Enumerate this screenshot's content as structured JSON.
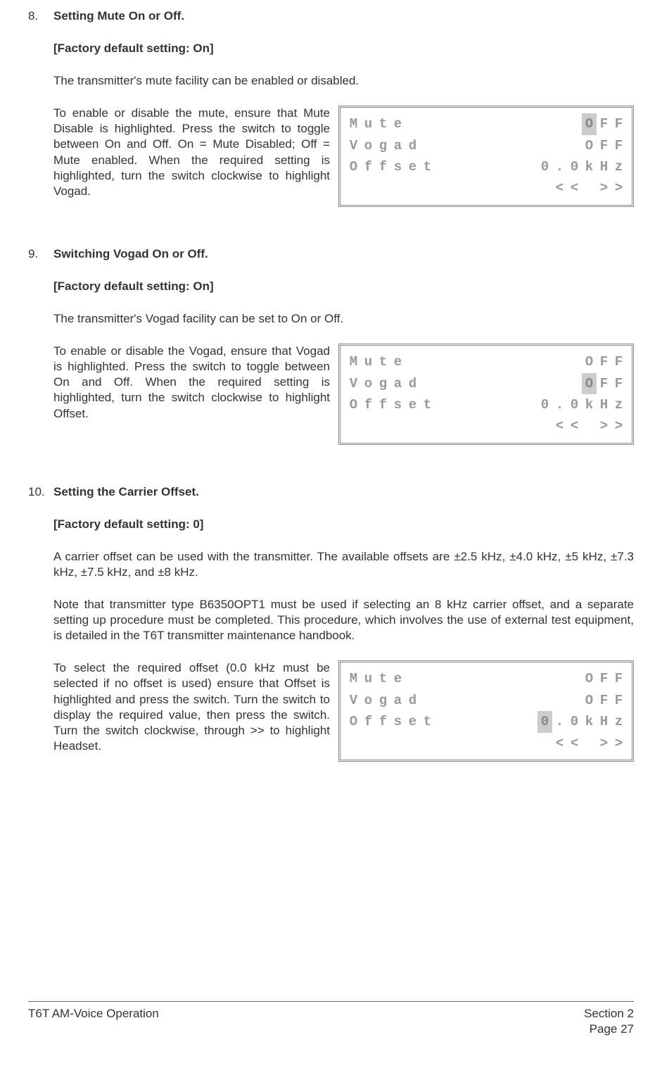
{
  "sections": [
    {
      "num": "8.",
      "title": "Setting Mute On or Off.",
      "default": "[Factory default setting: On]",
      "intro": "The transmitter's mute facility can be enabled or disabled.",
      "left_text": "To enable or disable the mute, ensure that Mute Disable is highlighted. Press the switch to toggle between On and Off. On = Mute Disabled; Off = Mute enabled. When the required setting is highlighted, turn the switch clockwise to highlight Vogad.",
      "lcd": {
        "row1_left": "Mute",
        "row1_right": "OFF",
        "row1_hl": 0,
        "row2_left": "Vogad",
        "row2_right": "OFF",
        "row2_hl": -1,
        "row3_left": "Offset",
        "row3_right": "0.0kHz",
        "row3_hl": -1,
        "row4_left": "",
        "row4_right": "<< >>"
      }
    },
    {
      "num": "9.",
      "title": "Switching Vogad On or Off.",
      "default": "[Factory default setting: On]",
      "intro": "The transmitter's Vogad facility can be set to On or Off.",
      "left_text": "To enable or disable the Vogad, ensure that Vogad is highlighted. Press the switch to toggle between On and Off. When the required setting is highlighted, turn the switch clockwise to highlight Offset.",
      "lcd": {
        "row1_left": "Mute",
        "row1_right": "OFF",
        "row1_hl": -1,
        "row2_left": "Vogad",
        "row2_right": "OFF",
        "row2_hl": 0,
        "row3_left": "Offset",
        "row3_right": "0.0kHz",
        "row3_hl": -1,
        "row4_left": "",
        "row4_right": "<< >>"
      }
    },
    {
      "num": "10.",
      "title": "Setting the Carrier Offset.",
      "default": "[Factory default setting: 0]",
      "intro": "A carrier offset can be used with the transmitter. The available offsets are ±2.5 kHz, ±4.0 kHz, ±5 kHz, ±7.3 kHz, ±7.5 kHz, and ±8 kHz.",
      "intro2": "Note that transmitter type B6350OPT1 must be used if selecting an 8 kHz carrier offset, and a separate setting up procedure must be completed. This procedure, which involves the use of external test equipment, is detailed in the T6T transmitter maintenance handbook.",
      "left_text": "To select the required offset (0.0 kHz must be selected if no offset is used) ensure that Offset is highlighted and press the switch. Turn the switch to display the required value, then press the switch. Turn the switch clockwise, through >>  to highlight Headset.",
      "lcd": {
        "row1_left": "Mute",
        "row1_right": "OFF",
        "row1_hl": -1,
        "row2_left": "Vogad",
        "row2_right": "OFF",
        "row2_hl": -1,
        "row3_left": "Offset",
        "row3_right": "0.0kHz",
        "row3_hl": 0,
        "row4_left": "",
        "row4_right": "<< >>"
      }
    }
  ],
  "footer": {
    "left": "T6T AM-Voice Operation",
    "right1": "Section 2",
    "right2": "Page 27"
  }
}
